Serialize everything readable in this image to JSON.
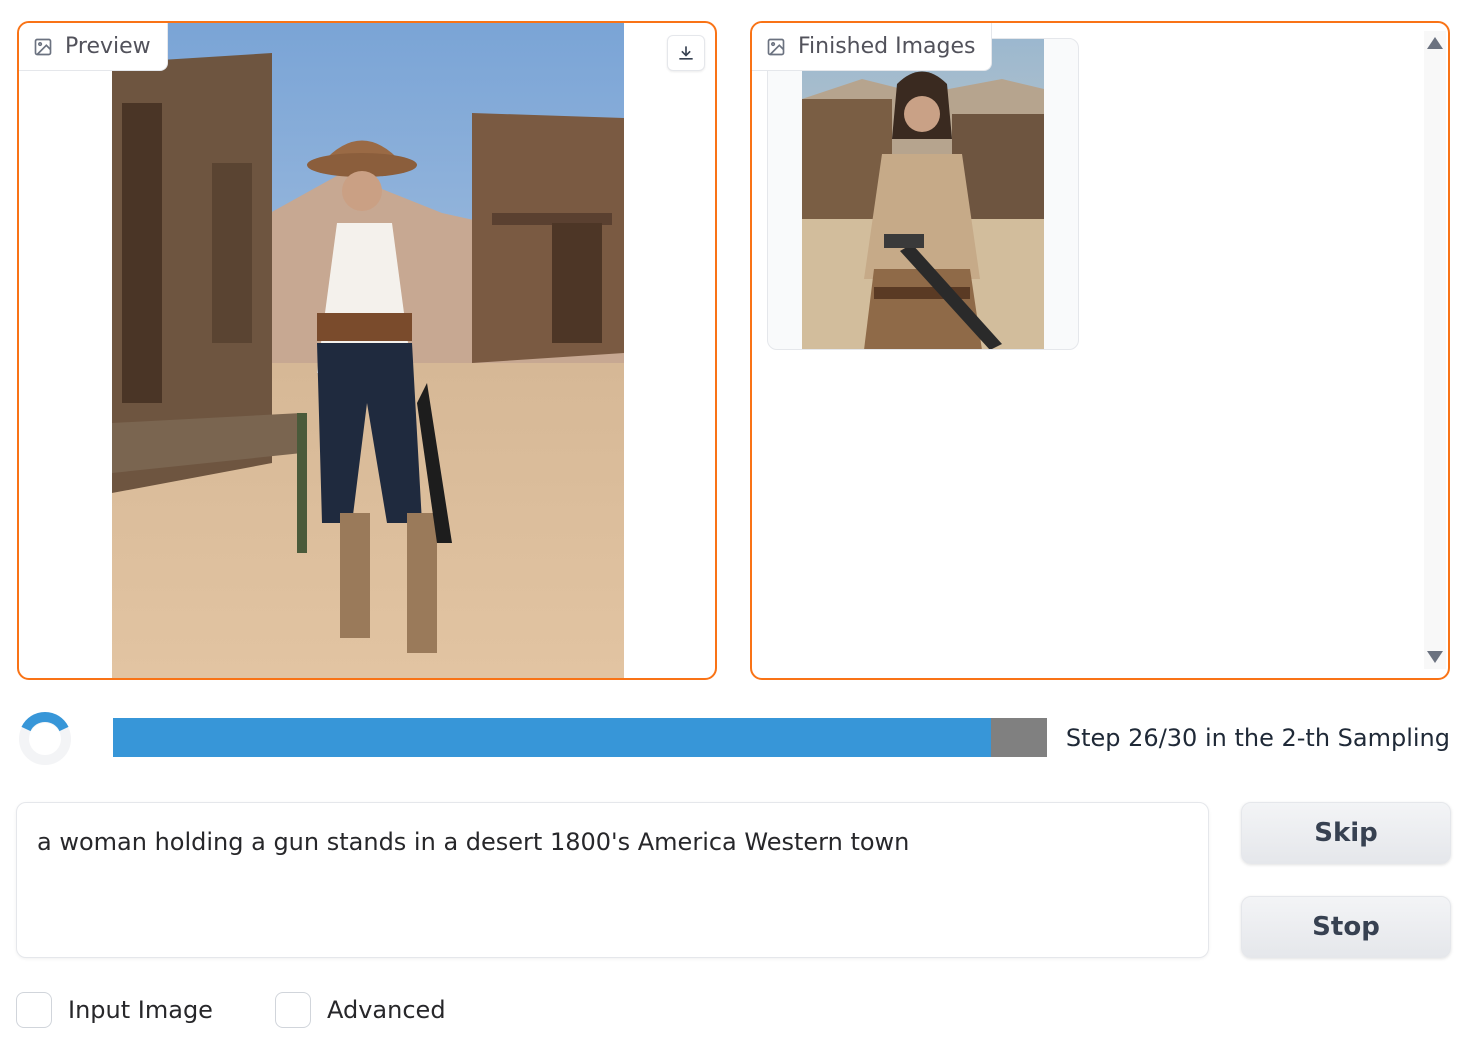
{
  "preview": {
    "label": "Preview",
    "icon": "image-icon",
    "download_icon": "download-icon"
  },
  "finished": {
    "label": "Finished Images",
    "icon": "image-icon"
  },
  "progress": {
    "fraction": 0.94,
    "text": "Step 26/30 in the 2-th Sampling",
    "fill_color": "#3796d8",
    "track_color": "#808080"
  },
  "prompt": {
    "value": "a woman holding a gun stands in a desert 1800's America Western town"
  },
  "buttons": {
    "skip": "Skip",
    "stop": "Stop"
  },
  "options": {
    "input_image": "Input Image",
    "advanced": "Advanced"
  },
  "colors": {
    "accent": "#f97316",
    "spinner": "#3796d8"
  }
}
